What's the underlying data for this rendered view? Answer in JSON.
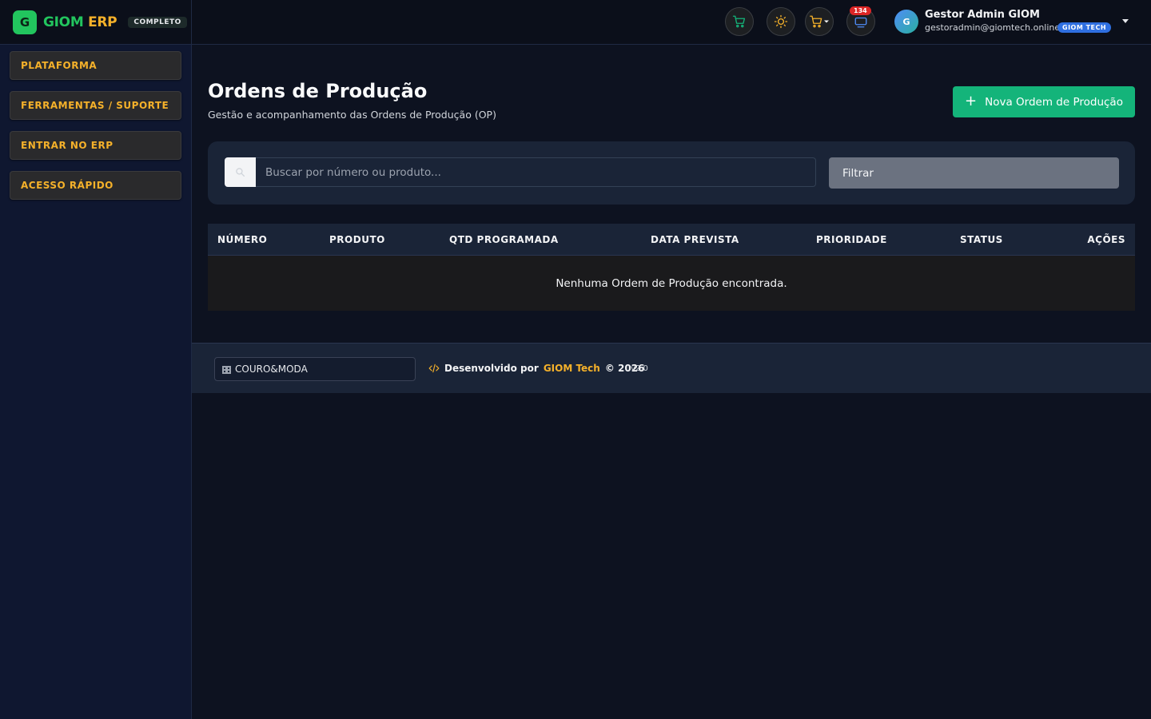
{
  "sidebar": {
    "logo_letter": "G",
    "brand_primary": "GIOM",
    "brand_secondary": "ERP",
    "edition_badge": "COMPLETO",
    "items": [
      {
        "label": "PLATAFORMA"
      },
      {
        "label": "FERRAMENTAS / SUPORTE"
      },
      {
        "label": "ENTRAR NO ERP"
      },
      {
        "label": "ACESSO RÁPIDO"
      }
    ]
  },
  "header": {
    "notifications_count": "134",
    "user": {
      "initial": "G",
      "name": "Gestor Admin GIOM",
      "email": "gestoradmin@giomtech.online",
      "tag": "GIOM TECH"
    },
    "icons": [
      "cart-icon",
      "sun-icon",
      "cart-dropdown-icon",
      "notification-icon"
    ]
  },
  "main": {
    "title": "Ordens de Produção",
    "subtitle": "Gestão e acompanhamento das Ordens de Produção (OP)",
    "new_button_label": "Nova Ordem de Produção",
    "search": {
      "placeholder": "Buscar por número ou produto...",
      "value": ""
    },
    "filter_label": "Filtrar",
    "table": {
      "columns": [
        "NÚMERO",
        "PRODUTO",
        "QTD PROGRAMADA",
        "DATA PREVISTA",
        "PRIORIDADE",
        "STATUS",
        "AÇÕES"
      ],
      "rows": [],
      "empty_message": "Nenhuma Ordem de Produção encontrada."
    }
  },
  "footer": {
    "company": "COURO&MODA",
    "developed_by": "Desenvolvido por",
    "developer": "GIOM Tech",
    "copyright": "© 2026",
    "version": "v2.0"
  },
  "colors": {
    "accent_green": "#14b47a",
    "brand_gold": "#f5b12a",
    "badge_red": "#dc2626",
    "tag_blue": "#2f6fe0"
  }
}
